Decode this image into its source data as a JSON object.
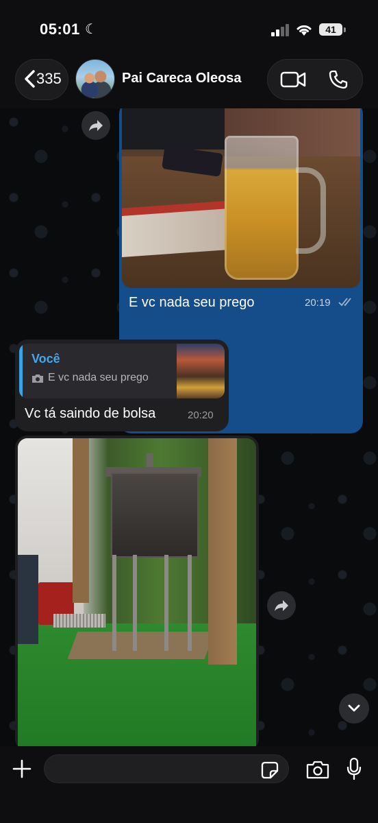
{
  "status_bar": {
    "time": "05:01",
    "battery": "41"
  },
  "header": {
    "back_count": "335",
    "contact_name": "Pai Careca Oleosa"
  },
  "messages": {
    "outgoing_photo": {
      "caption": "E vc nada seu prego",
      "time": "20:19",
      "status": "read"
    },
    "reply": {
      "quoted_author": "Você",
      "quoted_text": "E vc nada seu prego",
      "text": "Vc tá saindo de bolsa",
      "time": "20:20"
    }
  },
  "input": {
    "placeholder": ""
  },
  "colors": {
    "outgoing_bubble": "#144d8a",
    "incoming_bubble": "#1f1f22",
    "accent": "#3aa3e8"
  }
}
